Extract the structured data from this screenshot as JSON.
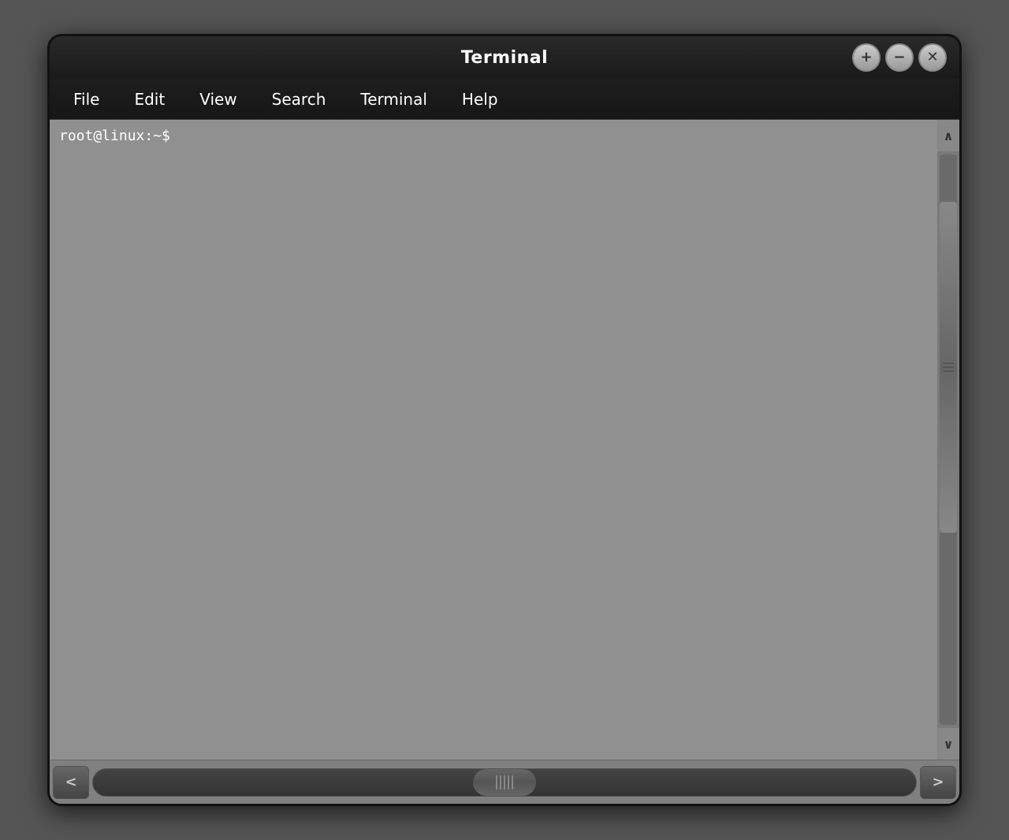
{
  "window": {
    "title": "Terminal",
    "controls": {
      "add": "+",
      "minimize": "−",
      "close": "✕"
    }
  },
  "menu": {
    "items": [
      "File",
      "Edit",
      "View",
      "Search",
      "Terminal",
      "Help"
    ]
  },
  "terminal": {
    "prompt": "root@linux:~$"
  },
  "scrollbar": {
    "up_arrow": "∧",
    "down_arrow": "∨",
    "left_arrow": "<",
    "right_arrow": ">"
  }
}
